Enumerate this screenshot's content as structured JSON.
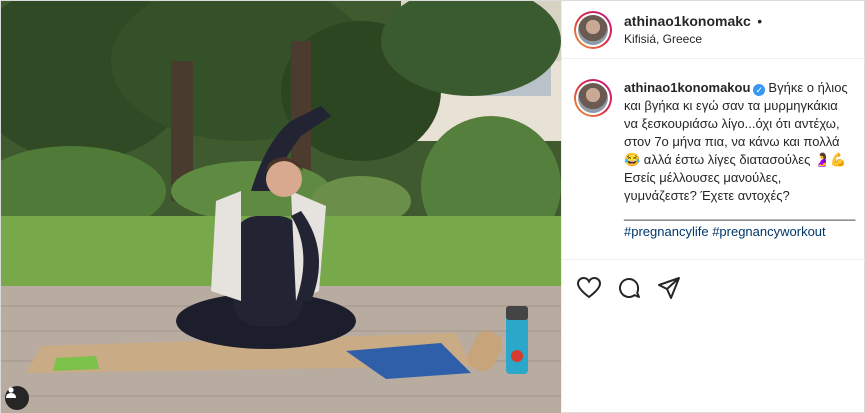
{
  "post": {
    "username": "athinao1konomakou",
    "header_username": "athinao1konomakc",
    "location": "Kifisiá, Greece",
    "follow_dot": "•",
    "caption": {
      "line1": "Βγήκε ο ήλιος και βγήκα κι εγώ σαν τα μυρμηγκάκια να ξεσκουριάσω λίγο...όχι ότι αντέχω, στον 7ο μήνα πια, να κάνω και πολλά",
      "emoji1": "😂",
      "line2": " αλλά έστω λίγες διατασούλες ",
      "emoji2": "🤰💪",
      "line3": "Εσείς μέλλουσες μανούλες, γυμνάζεστε? Έχετε αντοχές?",
      "separator": "________________________________",
      "hashtags": [
        "#pregnancylife",
        "#pregnancyworkout"
      ]
    },
    "verified_mark": "✓"
  },
  "icons": {
    "like": "heart-icon",
    "comment": "comment-icon",
    "share": "share-icon",
    "user_tag": "user-tag-icon"
  },
  "colors": {
    "link": "#00376b",
    "verified": "#3897f0",
    "text": "#262626"
  }
}
